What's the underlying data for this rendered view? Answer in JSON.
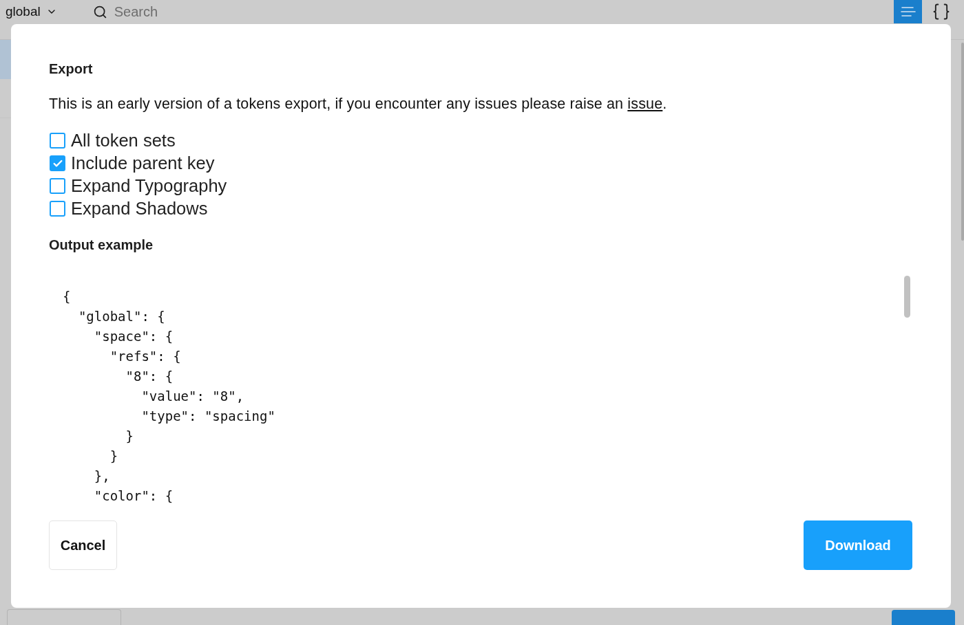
{
  "top_bar": {
    "token_set": "global",
    "search": {
      "placeholder": "Search"
    },
    "view_modes": [
      {
        "kind": "list",
        "selected": true
      },
      {
        "kind": "json",
        "selected": false
      }
    ]
  },
  "sidebar": {
    "rows": [
      {
        "selected": true
      },
      {
        "selected": false
      }
    ]
  },
  "export_dialog": {
    "title": "Export",
    "description": {
      "text": "This is an early version of a tokens export, if you encounter any issues please raise an ",
      "link": "issue",
      "end": "."
    },
    "options": [
      {
        "label": "All token sets",
        "checked": false
      },
      {
        "label": "Include parent key",
        "checked": true
      },
      {
        "label": "Expand Typography",
        "checked": false
      },
      {
        "label": "Expand Shadows",
        "checked": false
      }
    ],
    "output_label": "Output example",
    "output_lines": [
      "{",
      "  \"global\": {",
      "    \"space\": {",
      "      \"refs\": {",
      "        \"8\": {",
      "          \"value\": \"8\",",
      "          \"type\": \"spacing\"",
      "        }",
      "      }",
      "    },",
      "    \"color\": {"
    ],
    "cancel_button": "Cancel",
    "download_button": "Download"
  }
}
